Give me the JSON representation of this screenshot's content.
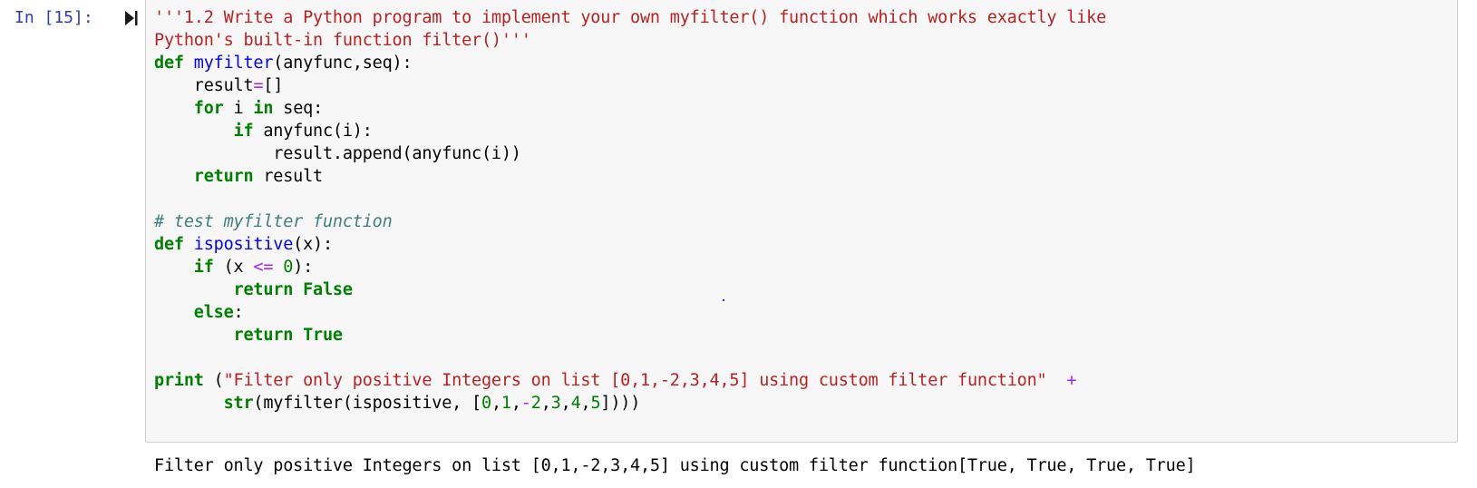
{
  "cell": {
    "prompt": "In [15]:",
    "code_lines": [
      [
        {
          "t": "str",
          "v": "'''1.2 Write a Python program to implement your own myfilter() function which works exactly like"
        }
      ],
      [
        {
          "t": "str",
          "v": "Python's built-in function filter()'''"
        }
      ],
      [
        {
          "t": "kw",
          "v": "def"
        },
        {
          "t": "plain",
          "v": " "
        },
        {
          "t": "fn",
          "v": "myfilter"
        },
        {
          "t": "plain",
          "v": "(anyfunc,seq):"
        }
      ],
      [
        {
          "t": "plain",
          "v": "    result"
        },
        {
          "t": "op",
          "v": "="
        },
        {
          "t": "plain",
          "v": "[]"
        }
      ],
      [
        {
          "t": "plain",
          "v": "    "
        },
        {
          "t": "kw",
          "v": "for"
        },
        {
          "t": "plain",
          "v": " i "
        },
        {
          "t": "kw",
          "v": "in"
        },
        {
          "t": "plain",
          "v": " seq:"
        }
      ],
      [
        {
          "t": "plain",
          "v": "        "
        },
        {
          "t": "kw",
          "v": "if"
        },
        {
          "t": "plain",
          "v": " anyfunc(i):"
        }
      ],
      [
        {
          "t": "plain",
          "v": "            result.append(anyfunc(i))"
        }
      ],
      [
        {
          "t": "plain",
          "v": "    "
        },
        {
          "t": "kw",
          "v": "return"
        },
        {
          "t": "plain",
          "v": " result"
        }
      ],
      [
        {
          "t": "plain",
          "v": ""
        }
      ],
      [
        {
          "t": "cm",
          "v": "# test myfilter function"
        }
      ],
      [
        {
          "t": "kw",
          "v": "def"
        },
        {
          "t": "plain",
          "v": " "
        },
        {
          "t": "fn",
          "v": "ispositive"
        },
        {
          "t": "plain",
          "v": "(x):"
        }
      ],
      [
        {
          "t": "plain",
          "v": "    "
        },
        {
          "t": "kw",
          "v": "if"
        },
        {
          "t": "plain",
          "v": " (x "
        },
        {
          "t": "op",
          "v": "<="
        },
        {
          "t": "plain",
          "v": " "
        },
        {
          "t": "num",
          "v": "0"
        },
        {
          "t": "plain",
          "v": "):"
        }
      ],
      [
        {
          "t": "plain",
          "v": "        "
        },
        {
          "t": "kw",
          "v": "return"
        },
        {
          "t": "plain",
          "v": " "
        },
        {
          "t": "kw",
          "v": "False"
        }
      ],
      [
        {
          "t": "plain",
          "v": "    "
        },
        {
          "t": "kw",
          "v": "else"
        },
        {
          "t": "plain",
          "v": ":"
        }
      ],
      [
        {
          "t": "plain",
          "v": "        "
        },
        {
          "t": "kw",
          "v": "return"
        },
        {
          "t": "plain",
          "v": " "
        },
        {
          "t": "kw",
          "v": "True"
        }
      ],
      [
        {
          "t": "plain",
          "v": ""
        }
      ],
      [
        {
          "t": "kw",
          "v": "print"
        },
        {
          "t": "plain",
          "v": " ("
        },
        {
          "t": "str",
          "v": "\"Filter only positive Integers on list [0,1,-2,3,4,5] using custom filter function\""
        },
        {
          "t": "plain",
          "v": "  "
        },
        {
          "t": "op",
          "v": "+"
        }
      ],
      [
        {
          "t": "plain",
          "v": "       "
        },
        {
          "t": "kw",
          "v": "str"
        },
        {
          "t": "plain",
          "v": "(myfilter(ispositive, ["
        },
        {
          "t": "num",
          "v": "0"
        },
        {
          "t": "plain",
          "v": ","
        },
        {
          "t": "num",
          "v": "1"
        },
        {
          "t": "plain",
          "v": ","
        },
        {
          "t": "op",
          "v": "-"
        },
        {
          "t": "num",
          "v": "2"
        },
        {
          "t": "plain",
          "v": ","
        },
        {
          "t": "num",
          "v": "3"
        },
        {
          "t": "plain",
          "v": ","
        },
        {
          "t": "num",
          "v": "4"
        },
        {
          "t": "plain",
          "v": ","
        },
        {
          "t": "num",
          "v": "5"
        },
        {
          "t": "plain",
          "v": "])))"
        }
      ]
    ],
    "output": "Filter only positive Integers on list [0,1,-2,3,4,5] using custom filter function[True, True, True, True]"
  },
  "colors": {
    "prompt": "#303f9f",
    "keyword": "#008000",
    "function_name": "#0000ff",
    "string": "#ba2121",
    "comment": "#408080",
    "operator": "#aa22ff",
    "number": "#008000",
    "cell_background": "#f7f7f7",
    "cell_border": "#cfcfcf"
  },
  "icons": {
    "run_indicator": "step-forward-icon"
  }
}
